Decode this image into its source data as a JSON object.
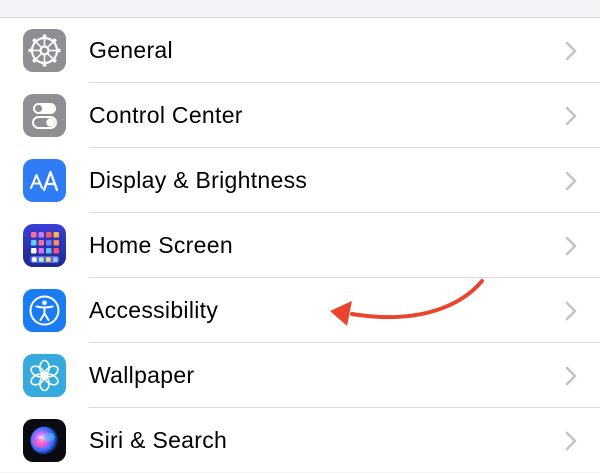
{
  "settings": {
    "items": [
      {
        "label": "General",
        "icon": "gear-icon",
        "color": "#8e8e93"
      },
      {
        "label": "Control Center",
        "icon": "toggle-switches-icon",
        "color": "#8e8e93"
      },
      {
        "label": "Display & Brightness",
        "icon": "text-size-icon",
        "color": "#2f7cf6"
      },
      {
        "label": "Home Screen",
        "icon": "app-grid-icon",
        "color": "#2745d6"
      },
      {
        "label": "Accessibility",
        "icon": "accessibility-person-icon",
        "color": "#1a7cf2"
      },
      {
        "label": "Wallpaper",
        "icon": "flower-icon",
        "color": "#35aadc"
      },
      {
        "label": "Siri & Search",
        "icon": "siri-icon",
        "color": "#111111"
      }
    ]
  },
  "annotation": {
    "type": "arrow",
    "color": "#e8452c",
    "points_to": "Accessibility"
  }
}
